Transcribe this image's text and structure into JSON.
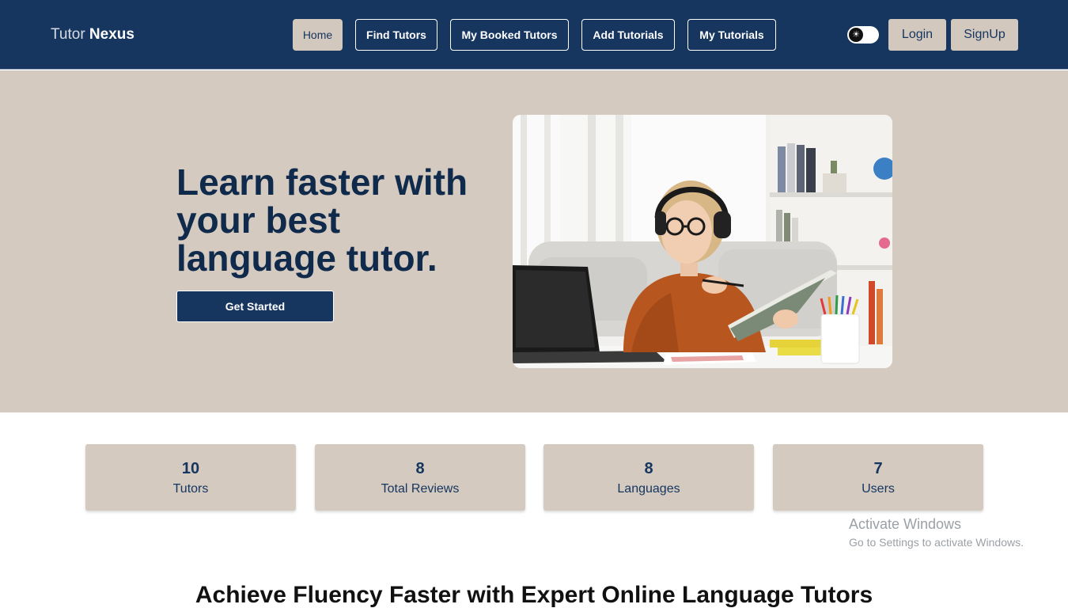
{
  "brand": {
    "part1": "Tutor",
    "part2": "Nexus"
  },
  "nav": {
    "items": [
      {
        "label": "Home",
        "active": true
      },
      {
        "label": "Find Tutors"
      },
      {
        "label": "My Booked Tutors"
      },
      {
        "label": "Add Tutorials"
      },
      {
        "label": "My Tutorials"
      }
    ],
    "theme_toggle_icon": "sun-icon",
    "login_label": "Login",
    "signup_label": "SignUp"
  },
  "hero": {
    "title": "Learn faster with your best language tutor.",
    "cta_label": "Get Started",
    "image": "student-with-headphones-image"
  },
  "stats": [
    {
      "value": "10",
      "label": "Tutors"
    },
    {
      "value": "8",
      "label": "Total Reviews"
    },
    {
      "value": "8",
      "label": "Languages"
    },
    {
      "value": "7",
      "label": "Users"
    }
  ],
  "watermark": {
    "line1": "Activate Windows",
    "line2": "Go to Settings to activate Windows."
  },
  "section": {
    "title": "Achieve Fluency Faster with Expert Online Language Tutors"
  },
  "colors": {
    "navy": "#163660",
    "beige": "#d4cac0",
    "white": "#ffffff"
  }
}
